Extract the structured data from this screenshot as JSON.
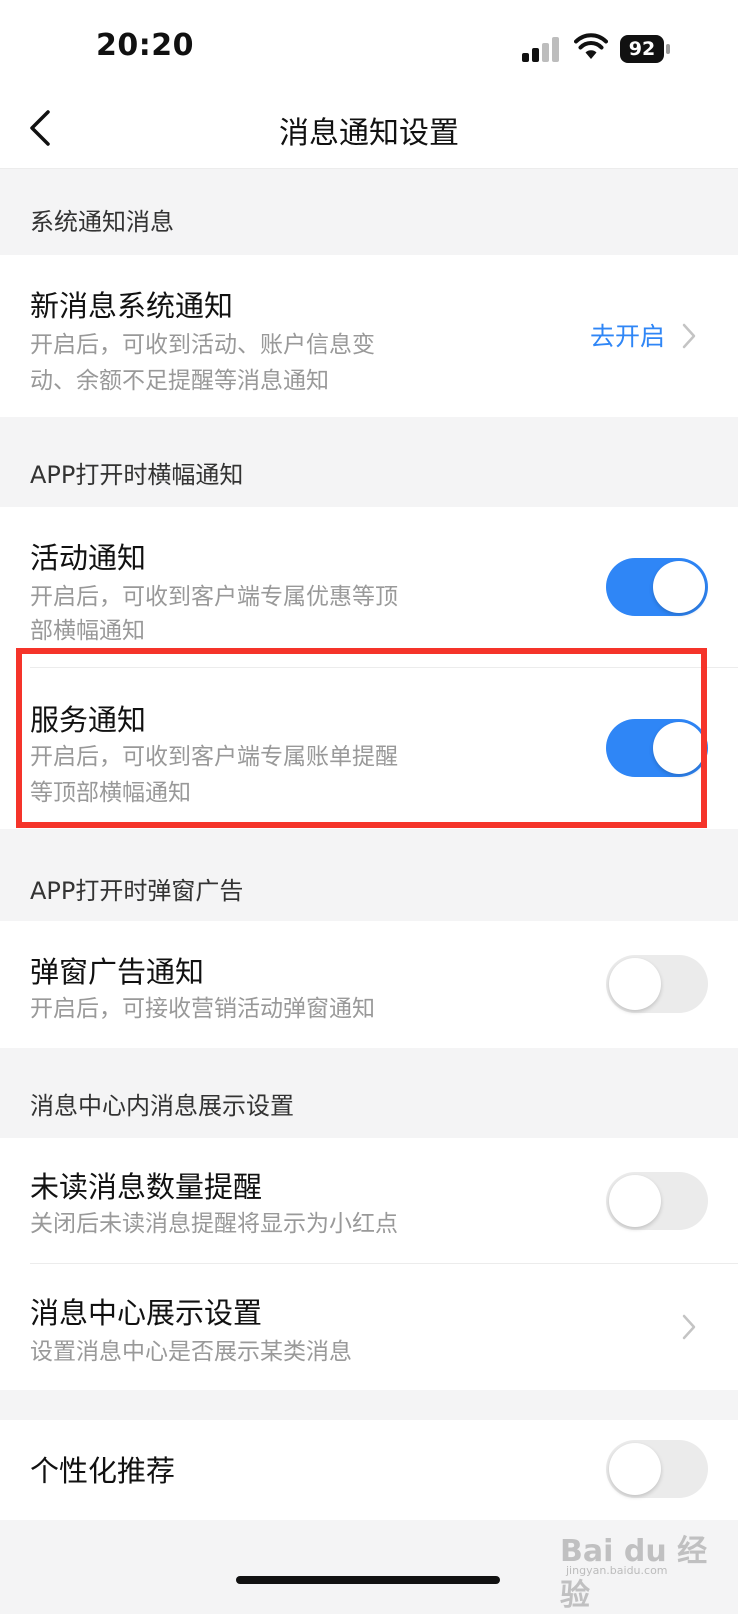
{
  "status_bar": {
    "time": "20:20",
    "battery": "92"
  },
  "nav": {
    "title": "消息通知设置"
  },
  "sections": {
    "system": {
      "header": "系统通知消息",
      "item": {
        "title": "新消息系统通知",
        "desc_line1": "开启后，可收到活动、账户信息变",
        "desc_line2": "动、余额不足提醒等消息通知",
        "action": "去开启"
      }
    },
    "banner": {
      "header": "APP打开时横幅通知",
      "activity": {
        "title": "活动通知",
        "desc_line1": "开启后，可收到客户端专属优惠等顶",
        "desc_line2": "部横幅通知",
        "enabled": true
      },
      "service": {
        "title": "服务通知",
        "desc_line1": "开启后，可收到客户端专属账单提醒",
        "desc_line2": "等顶部横幅通知",
        "enabled": true
      }
    },
    "popup": {
      "header": "APP打开时弹窗广告",
      "item": {
        "title": "弹窗广告通知",
        "desc": "开启后，可接收营销活动弹窗通知",
        "enabled": false
      }
    },
    "message_center": {
      "header": "消息中心内消息展示设置",
      "unread": {
        "title": "未读消息数量提醒",
        "desc": "关闭后未读消息提醒将显示为小红点",
        "enabled": false
      },
      "display": {
        "title": "消息中心展示设置",
        "desc": "设置消息中心是否展示某类消息"
      }
    },
    "personalized": {
      "title": "个性化推荐",
      "enabled": false
    }
  },
  "watermark": {
    "main": "Bai du 经验",
    "sub": "jingyan.baidu.com"
  },
  "colors": {
    "accent": "#2f86f6",
    "highlight": "#f5342a",
    "page_bg": "#f4f4f5"
  }
}
